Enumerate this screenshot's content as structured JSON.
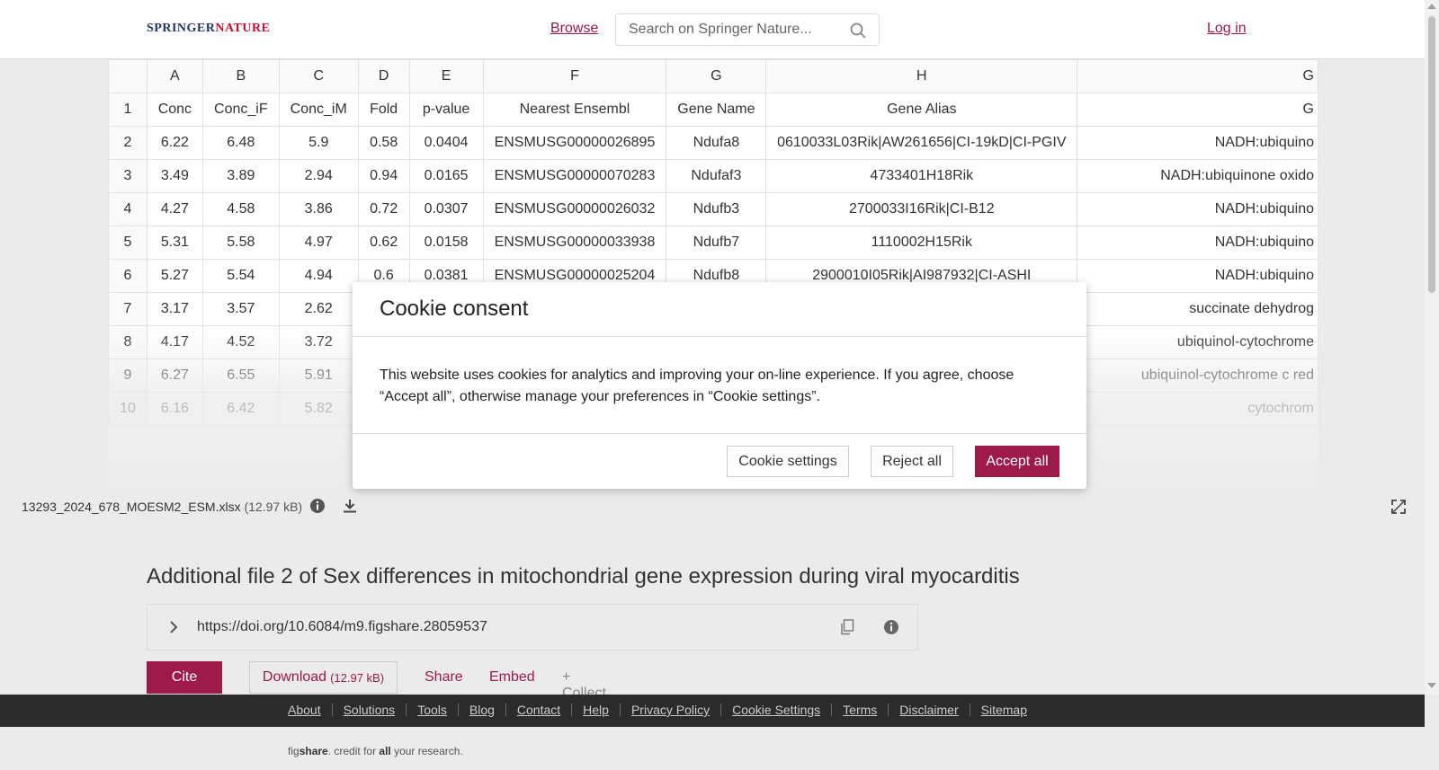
{
  "header": {
    "logo_part1": "SPRINGER",
    "logo_part2": "NATURE",
    "browse": "Browse",
    "search_placeholder": "Search on Springer Nature...",
    "login": "Log in"
  },
  "sheet": {
    "columns": [
      "A",
      "B",
      "C",
      "D",
      "E",
      "F",
      "G",
      "H",
      "G"
    ],
    "rows": [
      {
        "num": "1",
        "cells": [
          "Conc",
          "Conc_iF",
          "Conc_iM",
          "Fold",
          "p-value",
          "Nearest Ensembl",
          "Gene Name",
          "Gene Alias",
          "G"
        ]
      },
      {
        "num": "2",
        "cells": [
          "6.22",
          "6.48",
          "5.9",
          "0.58",
          "0.0404",
          "ENSMUSG00000026895",
          "Ndufa8",
          "0610033L03Rik|AW261656|CI-19kD|CI-PGIV",
          "NADH:ubiquino"
        ]
      },
      {
        "num": "3",
        "cells": [
          "3.49",
          "3.89",
          "2.94",
          "0.94",
          "0.0165",
          "ENSMUSG00000070283",
          "Ndufaf3",
          "4733401H18Rik",
          "NADH:ubiquinone oxido"
        ]
      },
      {
        "num": "4",
        "cells": [
          "4.27",
          "4.58",
          "3.86",
          "0.72",
          "0.0307",
          "ENSMUSG00000026032",
          "Ndufb3",
          "2700033I16Rik|CI-B12",
          "NADH:ubiquino"
        ]
      },
      {
        "num": "5",
        "cells": [
          "5.31",
          "5.58",
          "4.97",
          "0.62",
          "0.0158",
          "ENSMUSG00000033938",
          "Ndufb7",
          "1110002H15Rik",
          "NADH:ubiquino"
        ]
      },
      {
        "num": "6",
        "cells": [
          "5.27",
          "5.54",
          "4.94",
          "0.6",
          "0.0381",
          "ENSMUSG00000025204",
          "Ndufb8",
          "2900010I05Rik|AI987932|CI-ASHI",
          "NADH:ubiquino"
        ]
      },
      {
        "num": "7",
        "cells": [
          "3.17",
          "3.57",
          "2.62",
          "",
          "",
          "",
          "",
          "",
          "succinate dehydrog"
        ]
      },
      {
        "num": "8",
        "cells": [
          "4.17",
          "4.52",
          "3.72",
          "",
          "",
          "",
          "",
          "",
          "ubiquinol-cytochrome"
        ]
      },
      {
        "num": "9",
        "cells": [
          "6.27",
          "6.55",
          "5.91",
          "",
          "",
          "",
          "",
          "",
          "ubiquinol-cytochrome c red"
        ]
      },
      {
        "num": "10",
        "cells": [
          "6.16",
          "6.42",
          "5.82",
          "",
          "",
          "",
          "",
          "",
          "cytochrom"
        ]
      }
    ]
  },
  "file": {
    "name": "13293_2024_678_MOESM2_ESM.xlsx",
    "size": "(12.97 kB)"
  },
  "main": {
    "title": "Additional file 2 of Sex differences in mitochondrial gene expression during viral myocarditis",
    "doi": "https://doi.org/10.6084/m9.figshare.28059537",
    "cite": "Cite",
    "download": "Download",
    "download_size": "(12.97 kB)",
    "share": "Share",
    "embed": "Embed",
    "collect": "+ Collect"
  },
  "footer": {
    "links": [
      "About",
      "Solutions",
      "Tools",
      "Blog",
      "Contact",
      "Help",
      "Privacy Policy",
      "Cookie Settings",
      "Terms",
      "Disclaimer",
      "Sitemap"
    ],
    "tag_fig": "fig",
    "tag_share": "share",
    "tag_mid": ". credit for ",
    "tag_all": "all",
    "tag_end": " your research."
  },
  "modal": {
    "title": "Cookie consent",
    "body": "This website uses cookies for analytics and improving your on-line experience. If you agree, choose “Accept all”, otherwise manage your preferences in “Cookie settings”.",
    "settings": "Cookie settings",
    "reject": "Reject all",
    "accept": "Accept all"
  },
  "colors": {
    "accent": "#9e1a4a",
    "footer_bg": "#2b2b2b"
  }
}
